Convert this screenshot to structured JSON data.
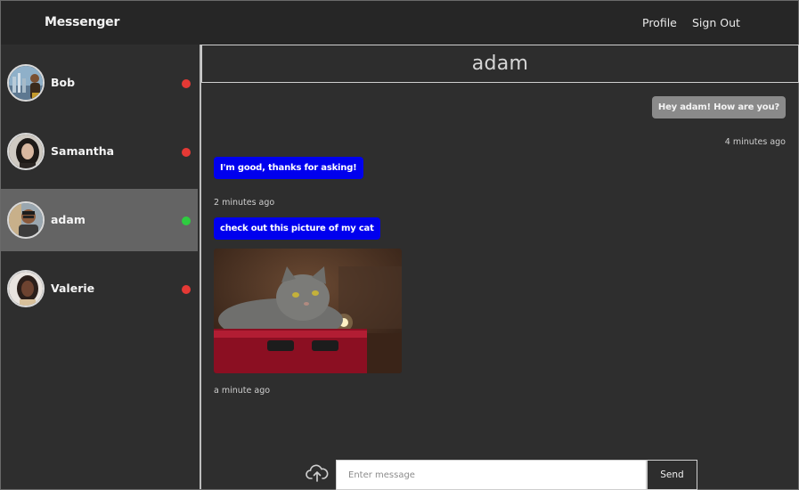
{
  "navbar": {
    "brand": "Messenger",
    "links": {
      "profile": "Profile",
      "sign_out": "Sign Out"
    }
  },
  "sidebar": {
    "contacts": [
      {
        "name": "Bob",
        "online": false,
        "status_color": "#e53935"
      },
      {
        "name": "Samantha",
        "online": false,
        "status_color": "#e53935"
      },
      {
        "name": "adam",
        "online": true,
        "status_color": "#2ecc40",
        "active": true
      },
      {
        "name": "Valerie",
        "online": false,
        "status_color": "#e53935"
      }
    ]
  },
  "chat": {
    "title": "adam",
    "messages": [
      {
        "direction": "sent",
        "text": "Hey adam! How are you?",
        "time": "4 minutes ago"
      },
      {
        "direction": "received",
        "text": "I'm good, thanks for asking!",
        "time": "2 minutes ago"
      },
      {
        "direction": "received",
        "text": "check out this picture of my cat",
        "attachment": "cat photo",
        "time": "a minute ago"
      }
    ]
  },
  "composer": {
    "placeholder": "Enter message",
    "send_label": "Send",
    "upload_icon": "cloud-upload-icon"
  },
  "colors": {
    "accent_bubble": "#0000ee",
    "sent_bubble": "#8a8a8a",
    "active_contact": "#646464",
    "offline": "#e53935",
    "online": "#2ecc40"
  }
}
